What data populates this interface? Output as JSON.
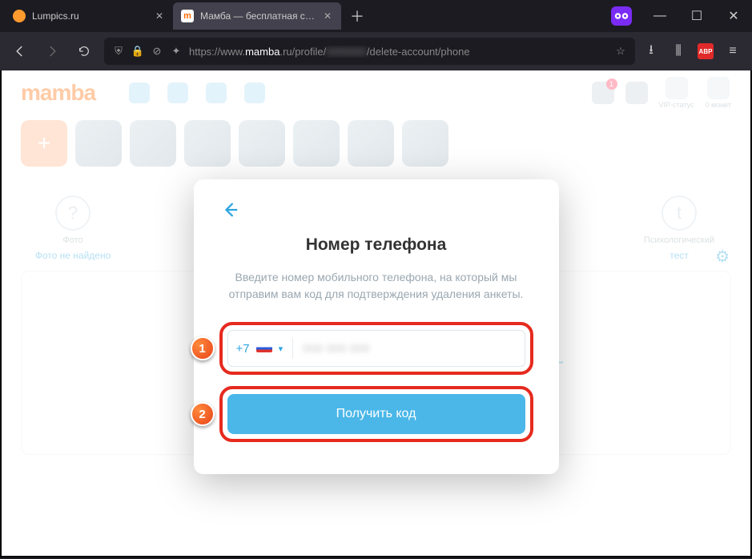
{
  "browser": {
    "tabs": [
      {
        "title": "Lumpics.ru",
        "active": false
      },
      {
        "title": "Мамба — бесплатная сеть зна",
        "active": true
      }
    ],
    "url": {
      "scheme": "https://",
      "host_pre": "www.",
      "host": "mamba",
      "host_post": ".ru",
      "path1": "/profile/",
      "path2": "/delete-account/phone"
    },
    "abp": "ABP"
  },
  "header": {
    "logo": "mamba",
    "vip": "VIP-статус",
    "coins": "0 монет",
    "notif": "1",
    "add_plus": "+"
  },
  "tiles": {
    "photo_label": "Фото",
    "photo_link": "Фото не найдено",
    "test_label": "Психологический",
    "test_link": "тест"
  },
  "card_plus": "+",
  "modal": {
    "title": "Номер телефона",
    "desc": "Введите номер мобильного телефона, на который мы отправим вам код для подтверждения удаления анкеты.",
    "cc": "+7",
    "phone_blur": "000 000 000",
    "button": "Получить код"
  },
  "anno": {
    "one": "1",
    "two": "2"
  }
}
